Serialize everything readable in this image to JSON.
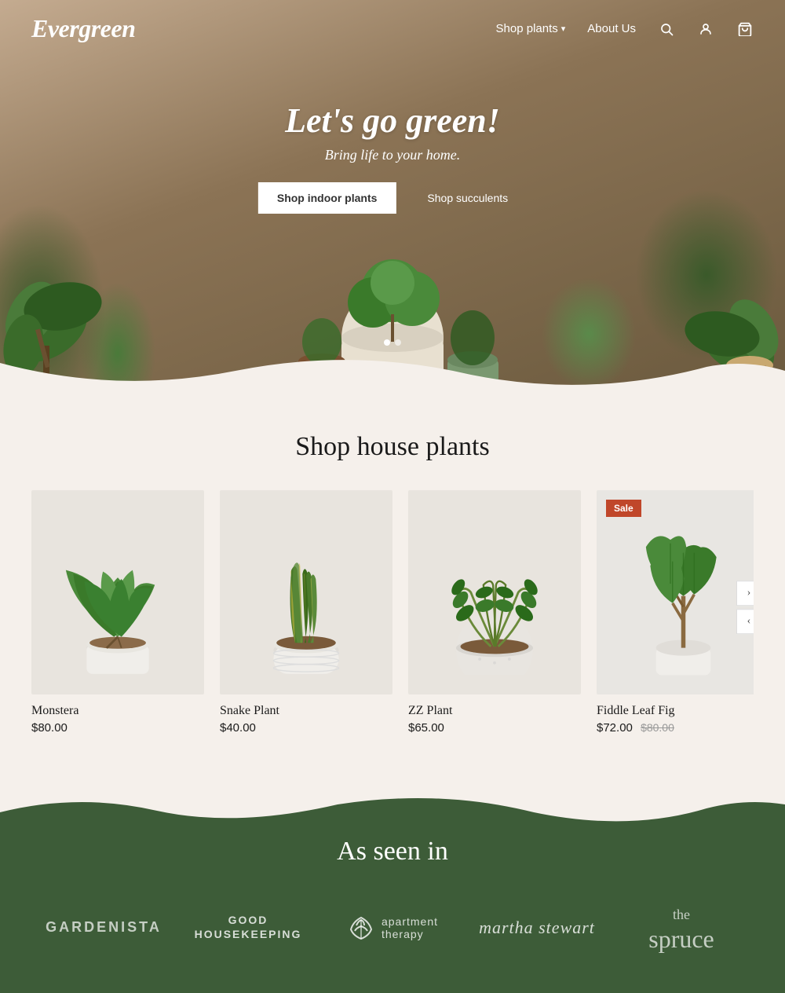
{
  "nav": {
    "logo": "Evergreen",
    "links": [
      {
        "label": "Shop plants",
        "has_dropdown": true
      },
      {
        "label": "About Us",
        "has_dropdown": false
      }
    ],
    "icons": {
      "search": "search-icon",
      "account": "account-icon",
      "cart": "cart-icon"
    }
  },
  "hero": {
    "title": "Let's go green!",
    "subtitle": "Bring life to your home.",
    "button_primary": "Shop indoor plants",
    "button_secondary": "Shop succulents"
  },
  "shop": {
    "title": "Shop house plants",
    "products": [
      {
        "name": "Monstera",
        "price": "$80.00",
        "original_price": null,
        "sale": false,
        "id": "monstera"
      },
      {
        "name": "Snake Plant",
        "price": "$40.00",
        "original_price": null,
        "sale": false,
        "id": "snake"
      },
      {
        "name": "ZZ Plant",
        "price": "$65.00",
        "original_price": null,
        "sale": false,
        "id": "zz"
      },
      {
        "name": "Fiddle Leaf Fig",
        "price": "$72.00",
        "original_price": "$80.00",
        "sale": true,
        "id": "fiddle"
      }
    ],
    "sale_label": "Sale"
  },
  "as_seen_in": {
    "title": "As seen in",
    "brands": [
      {
        "name": "GARDENISTA",
        "style": "gardenista"
      },
      {
        "name": "GOOD\nHOUSEKEEPING",
        "style": "goodhousekeeping"
      },
      {
        "name": "apartment therapy",
        "style": "apartment"
      },
      {
        "name": "martha stewart",
        "style": "martha"
      },
      {
        "name": "the spruce",
        "style": "spruce"
      }
    ]
  }
}
